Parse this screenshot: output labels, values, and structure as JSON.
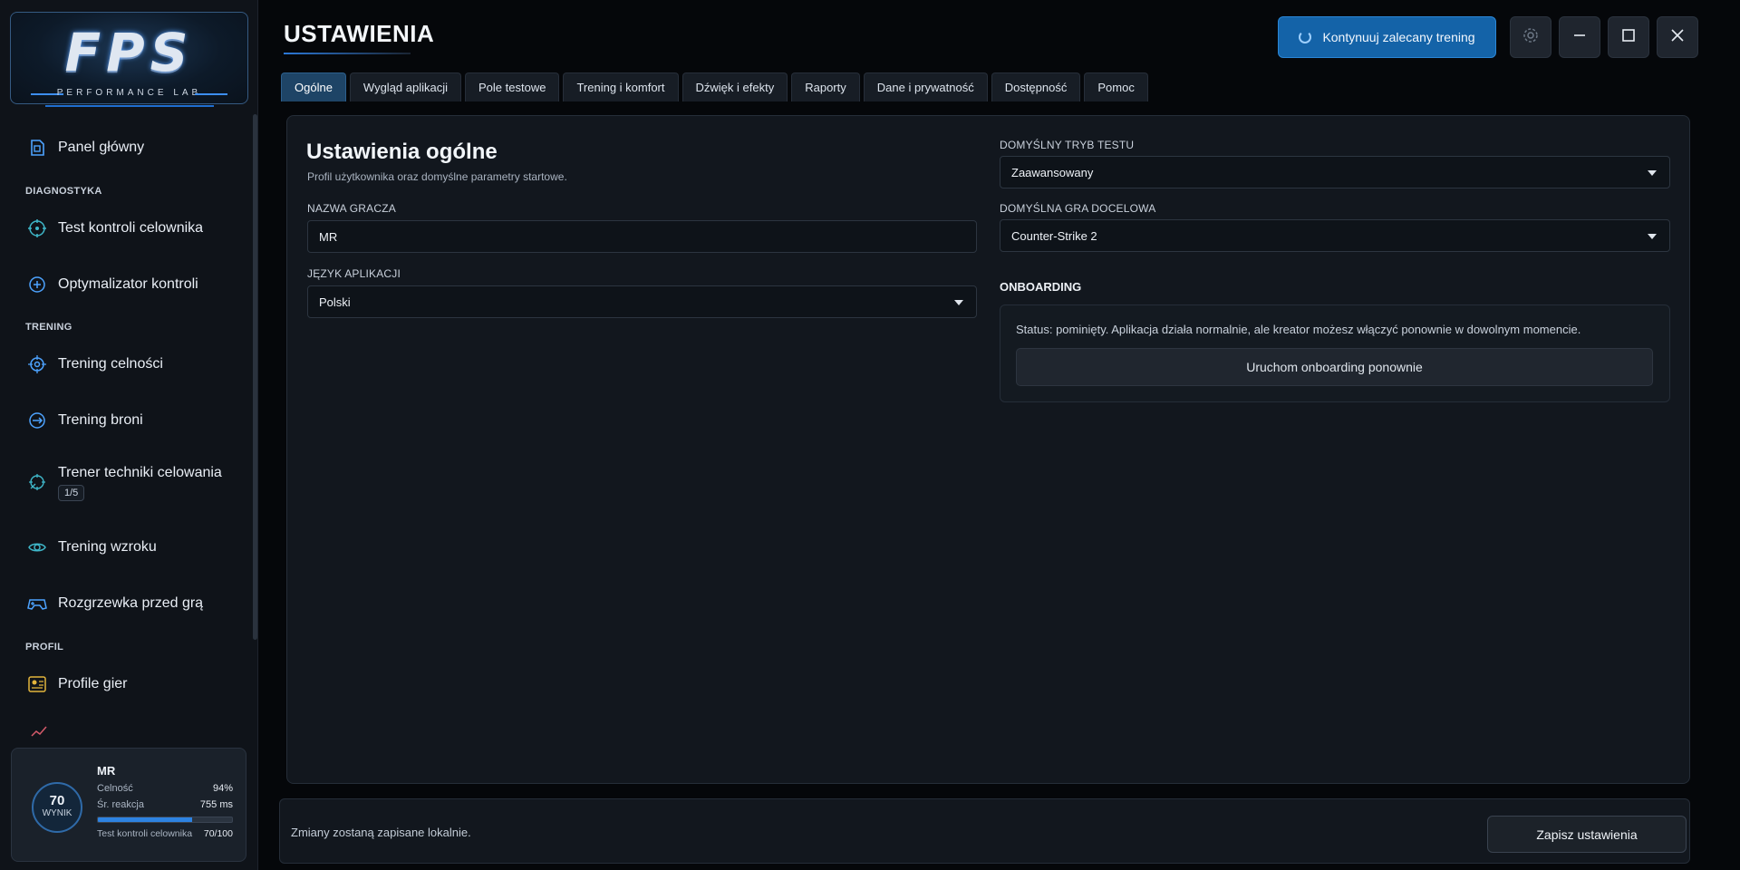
{
  "app": {
    "logo_main": "FPS",
    "logo_sub": "PERFORMANCE LAB"
  },
  "sidebar": {
    "items": [
      {
        "label": "Panel główny",
        "icon": "dashboard-icon"
      },
      {
        "label": "Test kontroli celownika",
        "icon": "crosshair-test-icon"
      },
      {
        "label": "Optymalizator kontroli",
        "icon": "optimizer-icon"
      },
      {
        "label": "Trening celności",
        "icon": "target-icon"
      },
      {
        "label": "Trening broni",
        "icon": "weapon-icon"
      },
      {
        "label": "Trener techniki celowania",
        "icon": "aim-technique-icon",
        "badge": "1/5"
      },
      {
        "label": "Trening wzroku",
        "icon": "eye-icon"
      },
      {
        "label": "Rozgrzewka przed grą",
        "icon": "gamepad-icon"
      },
      {
        "label": "Profile gier",
        "icon": "profile-card-icon"
      }
    ],
    "sections": {
      "diagnostics": "DIAGNOSTYKA",
      "training": "TRENING",
      "profile": "PROFIL"
    }
  },
  "profile_card": {
    "score": "70",
    "score_label": "WYNIK",
    "name": "MR",
    "accuracy_label": "Celność",
    "accuracy_value": "94%",
    "reaction_label": "Śr. reakcja",
    "reaction_value": "755 ms",
    "progress_fraction": 0.7,
    "test_label": "Test kontroli celownika",
    "test_value": "70/100"
  },
  "header": {
    "title": "USTAWIENIA",
    "cta_label": "Kontynuuj zalecany trening"
  },
  "tabs": [
    {
      "label": "Ogólne",
      "active": true
    },
    {
      "label": "Wygląd aplikacji"
    },
    {
      "label": "Pole testowe"
    },
    {
      "label": "Trening i komfort"
    },
    {
      "label": "Dźwięk i efekty"
    },
    {
      "label": "Raporty"
    },
    {
      "label": "Dane i prywatność"
    },
    {
      "label": "Dostępność"
    },
    {
      "label": "Pomoc"
    }
  ],
  "general": {
    "title": "Ustawienia ogólne",
    "subtitle": "Profil użytkownika oraz domyślne parametry startowe.",
    "player_name_label": "NAZWA GRACZA",
    "player_name_value": "MR",
    "language_label": "JĘZYK APLIKACJI",
    "language_value": "Polski",
    "test_mode_label": "DOMYŚLNY TRYB TESTU",
    "test_mode_value": "Zaawansowany",
    "target_game_label": "DOMYŚLNA GRA DOCELOWA",
    "target_game_value": "Counter-Strike 2",
    "onboarding_title": "ONBOARDING",
    "onboarding_status": "Status: pominięty. Aplikacja działa normalnie, ale kreator możesz włączyć ponownie w dowolnym momencie.",
    "onboarding_button": "Uruchom onboarding ponownie"
  },
  "footer": {
    "note": "Zmiany zostaną zapisane lokalnie.",
    "save_label": "Zapisz ustawienia"
  },
  "colors": {
    "accent": "#1463a8",
    "tab_active": "#1e4466",
    "background": "#05070a"
  }
}
